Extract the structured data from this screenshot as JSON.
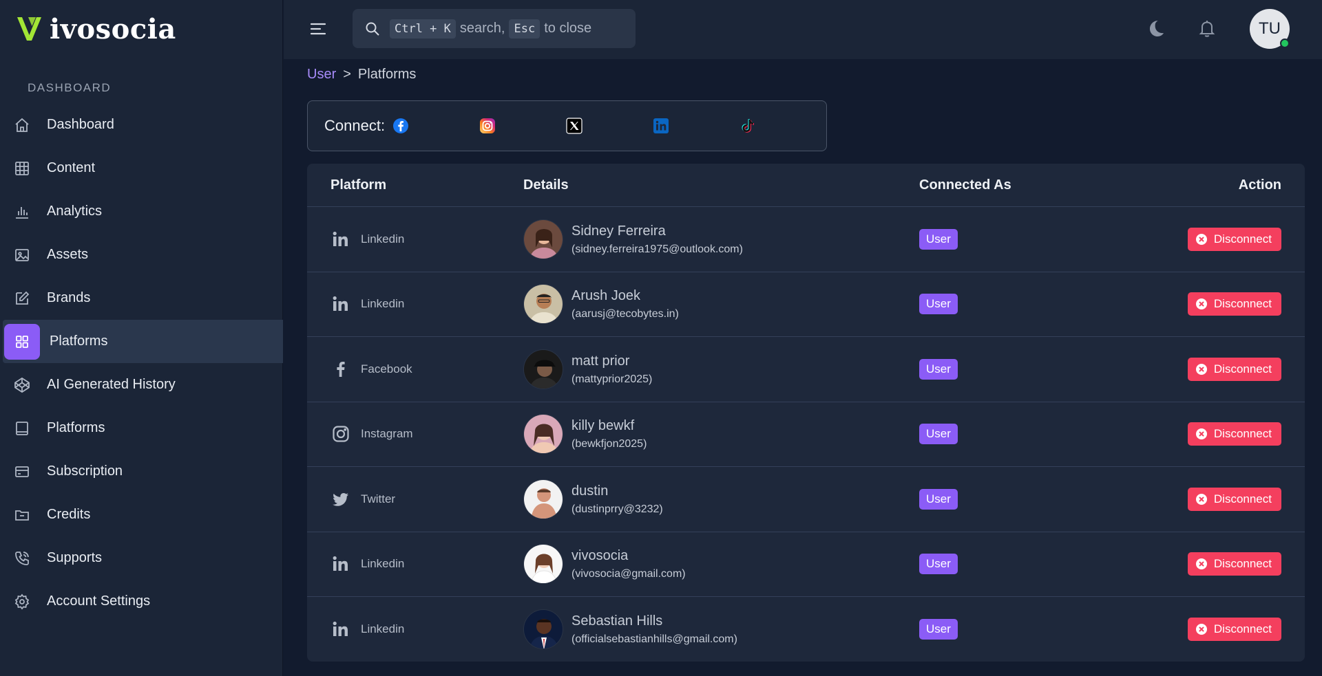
{
  "brand": {
    "name": "ivosocia",
    "accent": "#a3e635"
  },
  "sidebar": {
    "section_label": "DASHBOARD",
    "items": [
      {
        "label": "Dashboard",
        "icon": "home-icon"
      },
      {
        "label": "Content",
        "icon": "grid-icon"
      },
      {
        "label": "Analytics",
        "icon": "bar-chart-icon"
      },
      {
        "label": "Assets",
        "icon": "image-icon"
      },
      {
        "label": "Brands",
        "icon": "edit-icon"
      },
      {
        "label": "Platforms",
        "icon": "apps-icon",
        "active": true
      },
      {
        "label": "AI Generated History",
        "icon": "codepen-icon"
      },
      {
        "label": "Platforms",
        "icon": "book-icon"
      },
      {
        "label": "Subscription",
        "icon": "credit-card-icon"
      },
      {
        "label": "Credits",
        "icon": "folder-icon"
      },
      {
        "label": "Supports",
        "icon": "phone-icon"
      },
      {
        "label": "Account Settings",
        "icon": "settings-icon"
      }
    ]
  },
  "topbar": {
    "search": {
      "kbd1": "Ctrl + K",
      "text1": "search,",
      "kbd2": "Esc",
      "text2": "to close"
    },
    "user_initials": "TU"
  },
  "breadcrumb": {
    "root": "User",
    "separator": ">",
    "current": "Platforms"
  },
  "connect": {
    "label": "Connect:",
    "platforms": [
      "facebook",
      "instagram",
      "x",
      "linkedin",
      "tiktok"
    ]
  },
  "table": {
    "headers": {
      "platform": "Platform",
      "details": "Details",
      "connected_as": "Connected As",
      "action": "Action"
    },
    "action_label": "Disconnect",
    "rows": [
      {
        "platform": "Linkedin",
        "name": "Sidney Ferreira",
        "email": "(sidney.ferreira1975@outlook.com)",
        "role": "User"
      },
      {
        "platform": "Linkedin",
        "name": "Arush Joek",
        "email": "(aarusj@tecobytes.in)",
        "role": "User"
      },
      {
        "platform": "Facebook",
        "name": "matt prior",
        "email": "(mattyprior2025)",
        "role": "User"
      },
      {
        "platform": "Instagram",
        "name": "killy bewkf",
        "email": "(bewkfjon2025)",
        "role": "User"
      },
      {
        "platform": "Twitter",
        "name": "dustin",
        "email": "(dustinprry@3232)",
        "role": "User"
      },
      {
        "platform": "Linkedin",
        "name": "vivosocia",
        "email": "(vivosocia@gmail.com)",
        "role": "User"
      },
      {
        "platform": "Linkedin",
        "name": "Sebastian Hills",
        "email": "(officialsebastianhills@gmail.com)",
        "role": "User"
      }
    ]
  },
  "colors": {
    "accent": "#8b5cf6",
    "danger": "#f43f5e",
    "background": "#121b2e",
    "panel": "#1b2537"
  }
}
